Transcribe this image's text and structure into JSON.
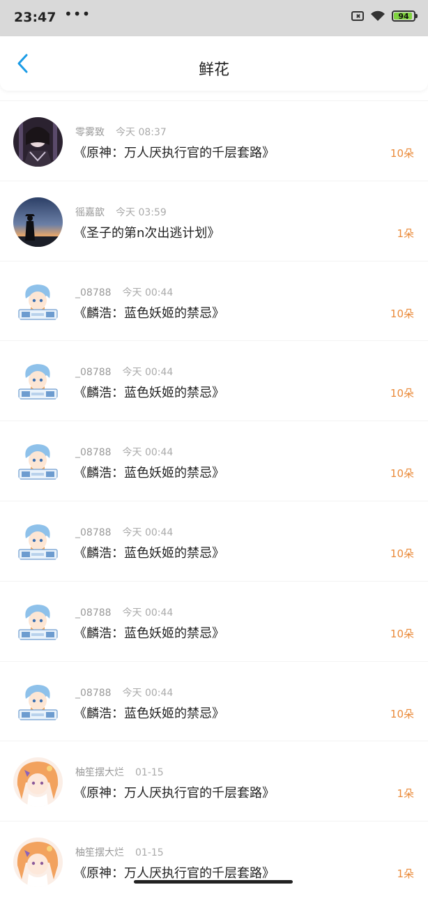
{
  "status_bar": {
    "time": "23:47",
    "dots": "•••",
    "battery": "94",
    "battery_fill_percent": 94
  },
  "nav": {
    "title": "鲜花",
    "back_icon": "chevron-left-icon"
  },
  "items": [
    {
      "user": "零雾致",
      "time": "今天 08:37",
      "book": "《原神：万人厌执行官的千层套路》",
      "count": "10朵",
      "avatar": "dark-anime-avatar"
    },
    {
      "user": "徭嘉歆",
      "time": "今天 03:59",
      "book": "《圣子的第n次出逃计划》",
      "count": "1朵",
      "avatar": "sunset-silhouette-avatar"
    },
    {
      "user": "_08788",
      "time": "今天 00:44",
      "book": "《麟浩：蓝色妖姬的禁忌》",
      "count": "10朵",
      "avatar": "blue-hair-chibi-avatar"
    },
    {
      "user": "_08788",
      "time": "今天 00:44",
      "book": "《麟浩：蓝色妖姬的禁忌》",
      "count": "10朵",
      "avatar": "blue-hair-chibi-avatar"
    },
    {
      "user": "_08788",
      "time": "今天 00:44",
      "book": "《麟浩：蓝色妖姬的禁忌》",
      "count": "10朵",
      "avatar": "blue-hair-chibi-avatar"
    },
    {
      "user": "_08788",
      "time": "今天 00:44",
      "book": "《麟浩：蓝色妖姬的禁忌》",
      "count": "10朵",
      "avatar": "blue-hair-chibi-avatar"
    },
    {
      "user": "_08788",
      "time": "今天 00:44",
      "book": "《麟浩：蓝色妖姬的禁忌》",
      "count": "10朵",
      "avatar": "blue-hair-chibi-avatar"
    },
    {
      "user": "_08788",
      "time": "今天 00:44",
      "book": "《麟浩：蓝色妖姬的禁忌》",
      "count": "10朵",
      "avatar": "blue-hair-chibi-avatar"
    },
    {
      "user": "柚笙摆大烂",
      "time": "01-15",
      "book": "《原神：万人厌执行官的千层套路》",
      "count": "1朵",
      "avatar": "orange-hair-anime-avatar"
    },
    {
      "user": "柚笙摆大烂",
      "time": "01-15",
      "book": "《原神：万人厌执行官的千层套路》",
      "count": "1朵",
      "avatar": "orange-hair-anime-avatar"
    }
  ],
  "colors": {
    "accent": "#1a9be6",
    "flower_count": "#ea8a39",
    "status_bar_bg": "#d9d9d9"
  }
}
